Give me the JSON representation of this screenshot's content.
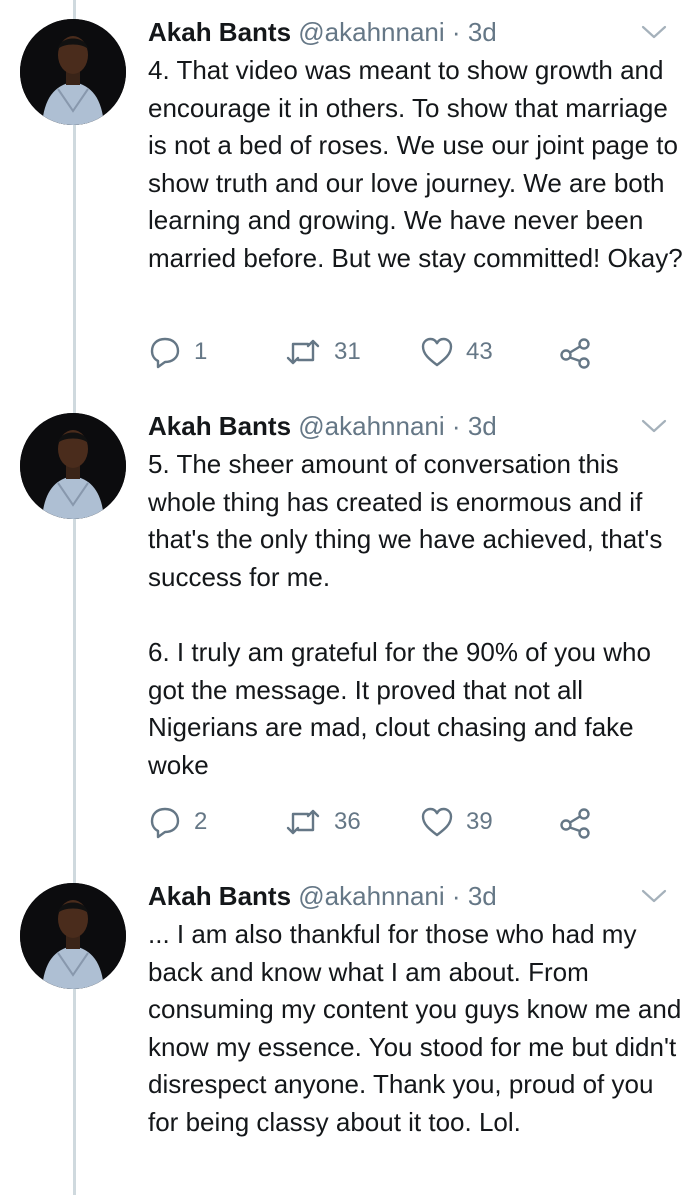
{
  "tweets": [
    {
      "author_name": "Akah Bants",
      "handle": "@akahnnani",
      "separator": "·",
      "time": "3d",
      "paragraphs": [
        "4. That video was meant to show growth and encourage it in others. To show that marriage is not a bed of roses. We use our joint page to show truth and our love journey. We are both learning and growing. We have never been married before. But we stay committed! Okay?"
      ],
      "replies": "1",
      "retweets": "31",
      "likes": "43"
    },
    {
      "author_name": "Akah Bants",
      "handle": "@akahnnani",
      "separator": "·",
      "time": "3d",
      "paragraphs": [
        "5. The sheer amount of conversation this whole thing has created is enormous and if that's the only thing we have achieved, that's success for me.",
        "6. I truly am grateful for the 90% of you who got the message. It proved that not all Nigerians are mad, clout chasing and fake woke"
      ],
      "replies": "2",
      "retweets": "36",
      "likes": "39"
    },
    {
      "author_name": "Akah Bants",
      "handle": "@akahnnani",
      "separator": "·",
      "time": "3d",
      "paragraphs": [
        "... I am also thankful for those who had my back and know what I am about. From consuming my content you guys know me and know my essence. You stood for me but didn't disrespect anyone. Thank you, proud of you for being classy about it too. Lol."
      ]
    }
  ],
  "colors": {
    "text": "#14171a",
    "secondary": "#657786",
    "thread_line": "#cfd9de"
  },
  "icons": {
    "reply": "reply-icon",
    "retweet": "retweet-icon",
    "like": "heart-icon",
    "share": "share-icon",
    "menu": "chevron-down-icon"
  }
}
